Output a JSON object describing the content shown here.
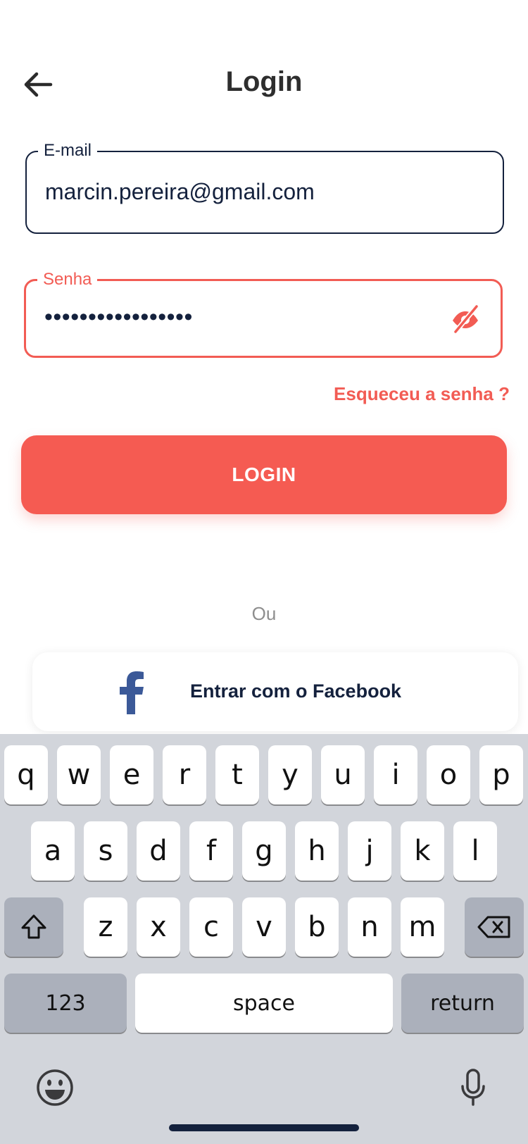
{
  "header": {
    "title": "Login",
    "back_icon": "arrow-left-icon"
  },
  "email_field": {
    "label": "E-mail",
    "value": "marcin.pereira@gmail.com"
  },
  "password_field": {
    "label": "Senha",
    "value": "•••••••••••••••••",
    "toggle_icon": "eye-off-icon"
  },
  "forgot_link": "Esqueceu a senha ?",
  "login_button": "LOGIN",
  "divider_text": "Ou",
  "facebook_button": {
    "label": "Entrar com o Facebook",
    "icon": "facebook-icon"
  },
  "keyboard": {
    "row1": [
      "q",
      "w",
      "e",
      "r",
      "t",
      "y",
      "u",
      "i",
      "o",
      "p"
    ],
    "row2": [
      "a",
      "s",
      "d",
      "f",
      "g",
      "h",
      "j",
      "k",
      "l"
    ],
    "row3": [
      "z",
      "x",
      "c",
      "v",
      "b",
      "n",
      "m"
    ],
    "numbers_key": "123",
    "space_key": "space",
    "return_key": "return",
    "shift_icon": "shift-icon",
    "backspace_icon": "backspace-icon",
    "emoji_icon": "emoji-icon",
    "mic_icon": "microphone-icon"
  },
  "colors": {
    "accent": "#f55b52",
    "navy": "#14213d",
    "facebook": "#3b5998",
    "keyboard_bg": "#d2d5db"
  }
}
